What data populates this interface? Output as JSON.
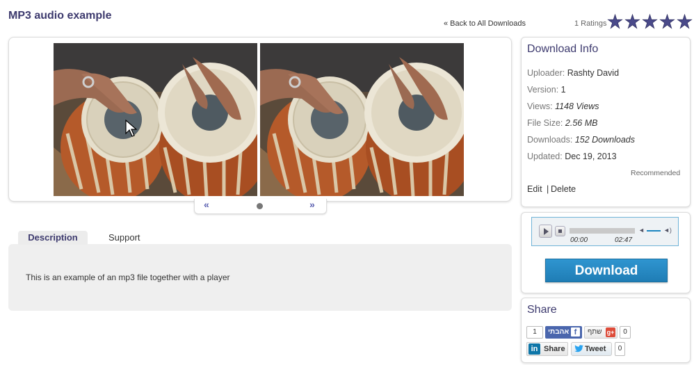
{
  "header": {
    "title": "MP3 audio example",
    "back_link": "« Back to All Downloads",
    "ratings_count": "1 Ratings",
    "star_rating": 5,
    "star_max": 5,
    "star_color": "#4a4a8a"
  },
  "gallery": {
    "prev": "«",
    "next": "»",
    "images": [
      "tabla-drums-photo",
      "tabla-drums-photo"
    ]
  },
  "tabs": {
    "items": [
      {
        "label": "Description",
        "active": true
      },
      {
        "label": "Support",
        "active": false
      }
    ],
    "description_text": "This is an example of an mp3 file together with a player"
  },
  "download_info": {
    "heading": "Download Info",
    "uploader_label": "Uploader:",
    "uploader_value": "Rashty David",
    "version_label": "Version:",
    "version_value": "1",
    "views_label": "Views:",
    "views_value": "1148 Views",
    "filesize_label": "File Size:",
    "filesize_value": "2.56 MB",
    "downloads_label": "Downloads:",
    "downloads_value": "152 Downloads",
    "updated_label": "Updated:",
    "updated_value": "Dec 19, 2013",
    "recommended": "Recommended",
    "edit": "Edit",
    "separator": "|",
    "delete": "Delete"
  },
  "player": {
    "current_time": "00:00",
    "total_time": "02:47",
    "accent": "#1a85c0"
  },
  "download_button": "Download",
  "share": {
    "heading": "Share",
    "fb_count": "1",
    "fb_like": "אהבתי",
    "fb_icon": "f",
    "g_share": "שתף",
    "g_icon": "g+",
    "g_count": "0",
    "li_icon": "in",
    "li_share": "Share",
    "tweet": "Tweet",
    "tweet_count": "0"
  }
}
